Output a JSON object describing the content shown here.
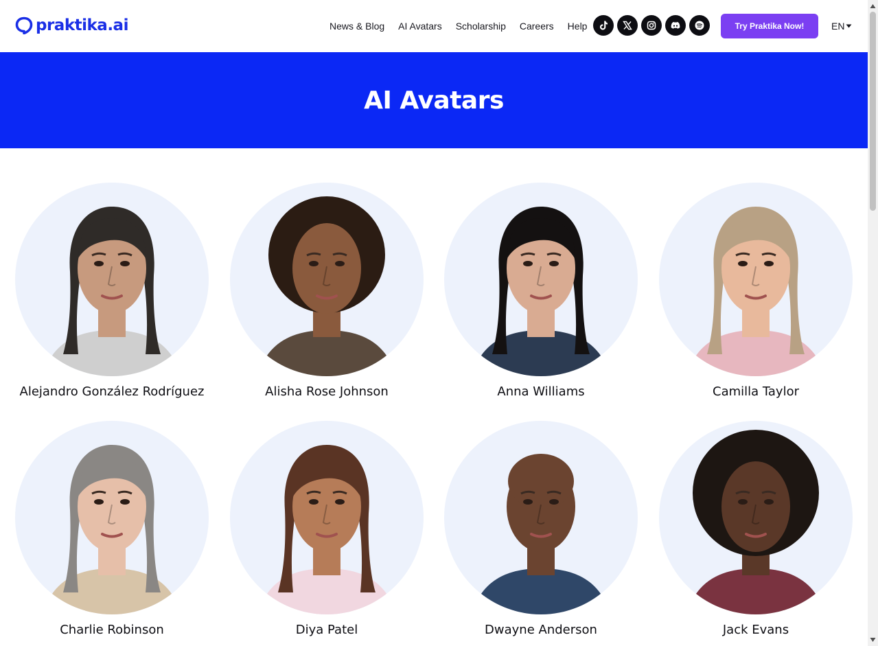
{
  "header": {
    "logo_text": "praktika.ai",
    "nav": [
      "News & Blog",
      "AI Avatars",
      "Scholarship",
      "Careers",
      "Help"
    ],
    "socials": [
      "tiktok-icon",
      "x-icon",
      "instagram-icon",
      "discord-icon",
      "spotify-icon"
    ],
    "cta_label": "Try Praktika Now!",
    "language": "EN"
  },
  "hero": {
    "title": "AI Avatars"
  },
  "avatars": [
    {
      "name": "Alejandro González Rodríguez"
    },
    {
      "name": "Alisha Rose Johnson"
    },
    {
      "name": "Anna Williams"
    },
    {
      "name": "Camilla Taylor"
    },
    {
      "name": "Charlie Robinson"
    },
    {
      "name": "Diya Patel"
    },
    {
      "name": "Dwayne Anderson"
    },
    {
      "name": "Jack Evans"
    }
  ],
  "colors": {
    "brand": "#1a2fe6",
    "hero_bg": "#0b28f5",
    "cta_bg": "#7b3ff2",
    "portrait_bg": "#edf2fc"
  }
}
